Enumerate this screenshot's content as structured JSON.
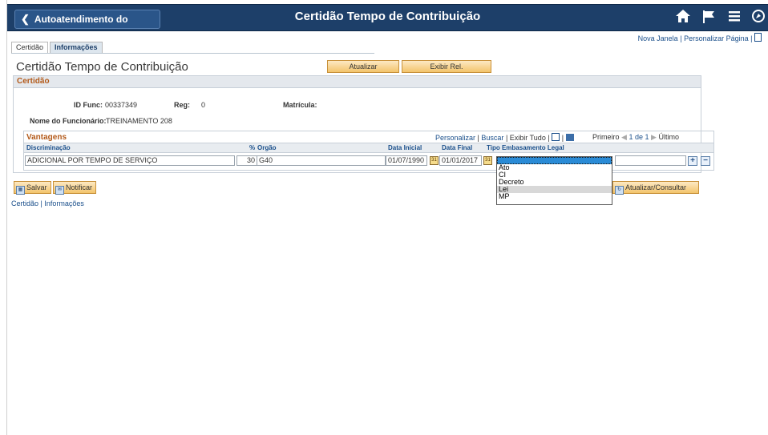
{
  "header": {
    "back_label": "Autoatendimento do Gerente",
    "title": "Certidão Tempo de Contribuição",
    "icons": [
      "home-icon",
      "flag-icon",
      "menu-icon",
      "navbar-icon"
    ]
  },
  "tabs": [
    {
      "label": "Certidão"
    },
    {
      "label": "Informações"
    }
  ],
  "toplinks": {
    "new_window": "Nova Janela",
    "separator": "|",
    "personalize": "Personalizar Página",
    "separator2": "|"
  },
  "page": {
    "title": "Certidão Tempo de Contribuição",
    "update_button": "Atualizar",
    "report_button": "Exibir Rel."
  },
  "section": {
    "title": "Certidão",
    "id_func_label": "ID Func:",
    "id_func_value": "00337349",
    "reg_label": "Reg:",
    "reg_value": "0",
    "matricula_label": "Matrícula:",
    "employee_name_label": "Nome do Funcionário:",
    "employee_name_value": "TREINAMENTO 208"
  },
  "grid": {
    "title": "Vantagens",
    "nav": {
      "personalize": "Personalizar",
      "sep1": "|",
      "search": "Buscar",
      "sep2": "|",
      "show_all": "Exibir Tudo",
      "sep3": "|",
      "first": "Primeiro",
      "range": "1 de 1",
      "last": "Último"
    },
    "columns": [
      "Discriminação",
      "%",
      "Orgão",
      "Data Inicial",
      "Data Final",
      "Tipo Embasamento Legal"
    ],
    "row": {
      "discriminacao": "ADICIONAL POR TEMPO DE SERVIÇO",
      "percent": "30",
      "orgao": "G40",
      "data_inicial": "01/07/1990",
      "data_final": "01/01/2017"
    }
  },
  "dropdown": {
    "options": [
      "",
      "Ato",
      "CI",
      "Decreto",
      "Lei",
      "MP"
    ],
    "hover_index": 4
  },
  "footer": {
    "save": "Salvar",
    "notify": "Notificar",
    "refresh": "Atualizar/Consultar"
  },
  "bottom_links": {
    "certidao": "Certidão",
    "sep": "|",
    "informacoes": "Informações"
  },
  "colors": {
    "header_bg": "#1d3f69",
    "section_title": "#b35a1a",
    "link": "#1a4f8b",
    "button": "#f3c46b"
  }
}
